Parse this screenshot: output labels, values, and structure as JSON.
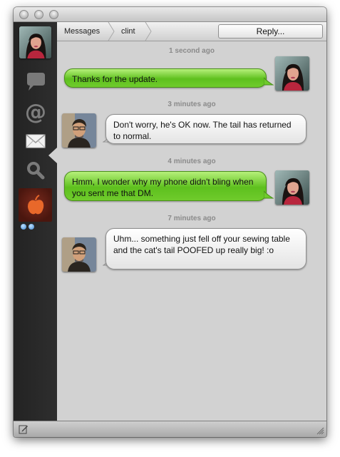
{
  "toolbar": {
    "breadcrumb": [
      "Messages",
      "clint"
    ],
    "reply_label": "Reply..."
  },
  "sidebar": {
    "items": [
      {
        "icon": "user-avatar"
      },
      {
        "icon": "speech-bubble-icon"
      },
      {
        "icon": "at-icon",
        "glyph": "@"
      },
      {
        "icon": "envelope-icon",
        "selected": true
      },
      {
        "icon": "search-icon"
      },
      {
        "icon": "apple-icon"
      }
    ]
  },
  "messages": [
    {
      "time": "1 second ago",
      "text": "Thanks for the update.",
      "from": "me"
    },
    {
      "time": "3 minutes ago",
      "text": "Don't worry, he's OK now.  The tail has returned to normal.",
      "from": "clint"
    },
    {
      "time": "4 minutes ago",
      "text": "Hmm, I wonder why my phone didn't bling when you sent me that DM.",
      "from": "me"
    },
    {
      "time": "7 minutes ago",
      "text": "Uhm... something just fell off your sewing table and the cat's tail POOFED up really big! :o",
      "from": "clint"
    }
  ],
  "colors": {
    "sent_bubble": "#6fcb2c",
    "received_bubble": "#f4f4f4",
    "sidebar_bg": "#2a2a2a",
    "content_bg": "#d2d2d2"
  }
}
